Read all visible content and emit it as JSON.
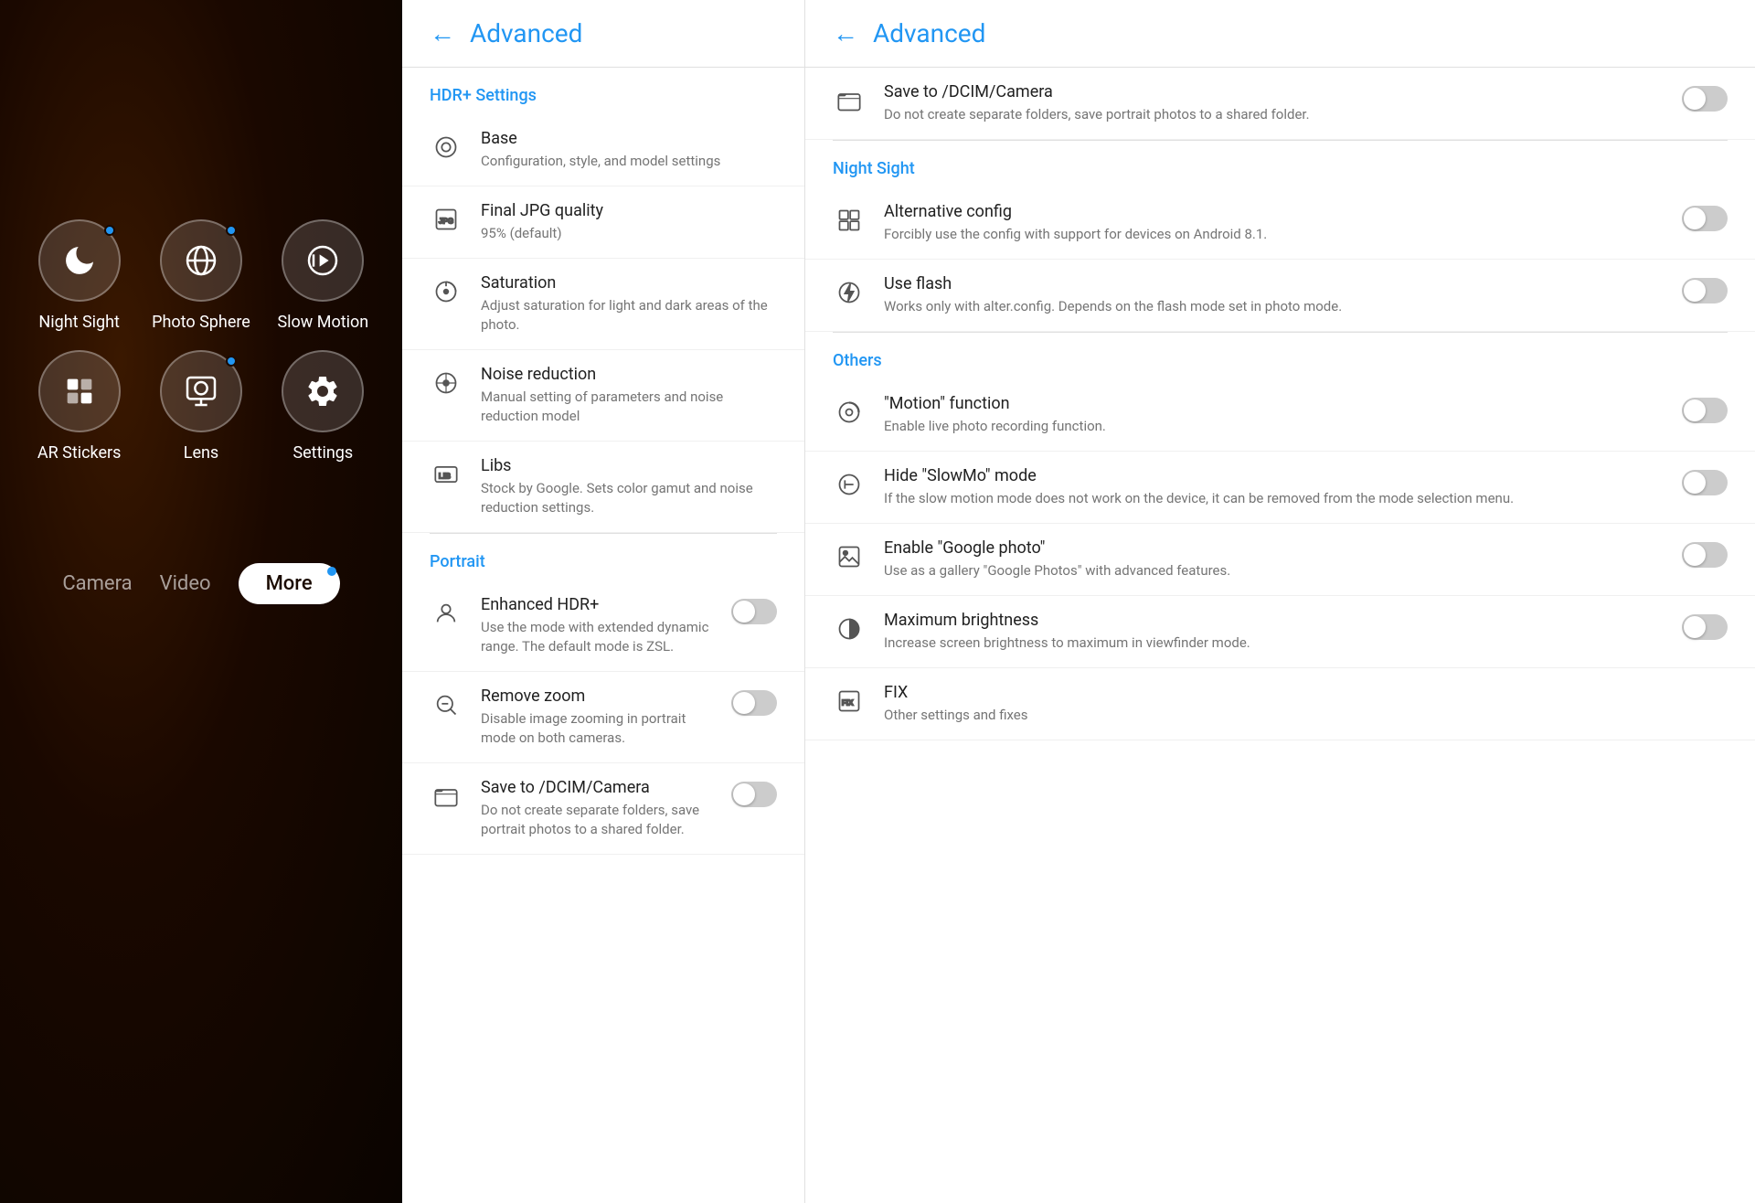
{
  "leftPanel": {
    "items": [
      {
        "id": "night-sight",
        "label": "Night Sight",
        "hasDot": true
      },
      {
        "id": "photo-sphere",
        "label": "Photo Sphere",
        "hasDot": true
      },
      {
        "id": "slow-motion",
        "label": "Slow Motion",
        "hasDot": false
      },
      {
        "id": "ar-stickers",
        "label": "AR Stickers",
        "hasDot": false
      },
      {
        "id": "lens",
        "label": "Lens",
        "hasDot": true
      },
      {
        "id": "settings",
        "label": "Settings",
        "hasDot": false
      }
    ],
    "tabs": [
      {
        "id": "camera",
        "label": "Camera",
        "active": false
      },
      {
        "id": "video",
        "label": "Video",
        "active": false
      },
      {
        "id": "more",
        "label": "More",
        "active": true
      }
    ]
  },
  "middlePanel": {
    "header": {
      "back": "←",
      "title": "Advanced"
    },
    "sections": [
      {
        "id": "hdr-settings",
        "label": "HDR+ Settings",
        "items": [
          {
            "id": "base",
            "name": "Base",
            "desc": "Configuration, style, and model settings",
            "hasToggle": false
          },
          {
            "id": "final-jpg",
            "name": "Final JPG quality",
            "desc": "95% (default)",
            "hasToggle": false
          },
          {
            "id": "saturation",
            "name": "Saturation",
            "desc": "Adjust saturation for light and dark areas of the photo.",
            "hasToggle": false
          },
          {
            "id": "noise-reduction",
            "name": "Noise reduction",
            "desc": "Manual setting of parameters and noise reduction model",
            "hasToggle": false
          },
          {
            "id": "libs",
            "name": "Libs",
            "desc": "Stock by Google. Sets color gamut and noise reduction settings.",
            "hasToggle": false
          }
        ]
      },
      {
        "id": "portrait",
        "label": "Portrait",
        "items": [
          {
            "id": "enhanced-hdr",
            "name": "Enhanced HDR+",
            "desc": "Use the mode with extended dynamic range. The default mode is ZSL.",
            "hasToggle": true,
            "toggleOn": false
          },
          {
            "id": "remove-zoom",
            "name": "Remove zoom",
            "desc": "Disable image zooming in portrait mode on both cameras.",
            "hasToggle": true,
            "toggleOn": false
          },
          {
            "id": "save-dcim-middle",
            "name": "Save to /DCIM/Camera",
            "desc": "Do not create separate folders, save portrait photos to a shared folder.",
            "hasToggle": true,
            "toggleOn": false
          }
        ]
      }
    ]
  },
  "rightPanel": {
    "header": {
      "back": "←",
      "title": "Advanced"
    },
    "sections": [
      {
        "id": "top-portrait",
        "label": "",
        "items": [
          {
            "id": "save-dcim-right",
            "name": "Save to /DCIM/Camera",
            "desc": "Do not create separate folders, save portrait photos to a shared folder.",
            "hasToggle": true,
            "toggleOn": false
          }
        ]
      },
      {
        "id": "night-sight",
        "label": "Night Sight",
        "items": [
          {
            "id": "alt-config",
            "name": "Alternative config",
            "desc": "Forcibly use the config with support for devices on Android 8.1.",
            "hasToggle": true,
            "toggleOn": false
          },
          {
            "id": "use-flash",
            "name": "Use flash",
            "desc": "Works only with alter.config. Depends on the flash mode set in photo mode.",
            "hasToggle": true,
            "toggleOn": false
          }
        ]
      },
      {
        "id": "others",
        "label": "Others",
        "items": [
          {
            "id": "motion-function",
            "name": "\"Motion\" function",
            "desc": "Enable live photo recording function.",
            "hasToggle": true,
            "toggleOn": false
          },
          {
            "id": "hide-slowmo",
            "name": "Hide \"SlowMo\" mode",
            "desc": "If the slow motion mode does not work on the device, it can be removed from the mode selection menu.",
            "hasToggle": true,
            "toggleOn": false
          },
          {
            "id": "enable-google-photo",
            "name": "Enable \"Google photo\"",
            "desc": "Use as a gallery \"Google Photos\" with advanced features.",
            "hasToggle": true,
            "toggleOn": false
          },
          {
            "id": "maximum-brightness",
            "name": "Maximum brightness",
            "desc": "Increase screen brightness to maximum in viewfinder mode.",
            "hasToggle": true,
            "toggleOn": false
          },
          {
            "id": "fix",
            "name": "FIX",
            "desc": "Other settings and fixes",
            "hasToggle": false
          }
        ]
      }
    ]
  }
}
